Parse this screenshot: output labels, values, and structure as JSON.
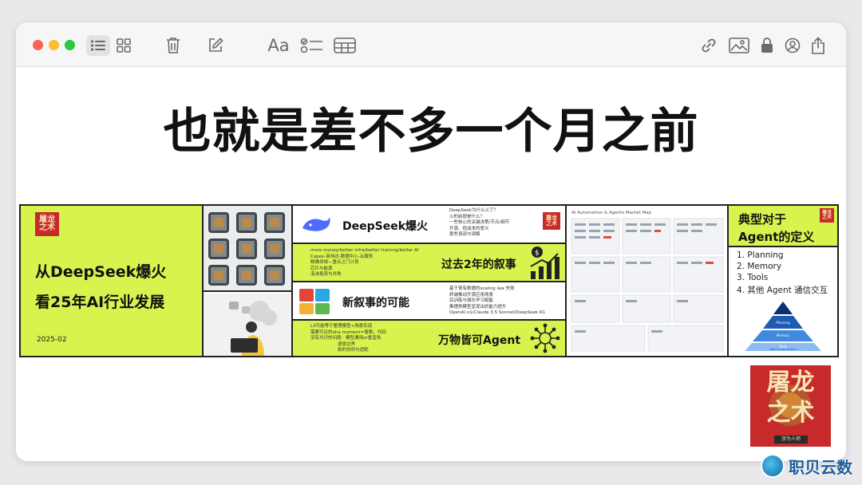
{
  "toolbar": {
    "buttons": [
      "list-view",
      "gallery-view",
      "delete",
      "compose",
      "format",
      "checklist",
      "table",
      "link",
      "media",
      "lock",
      "collaborate",
      "share"
    ],
    "format_label": "Aa"
  },
  "note": {
    "headline": "也就是差不多一个月之前"
  },
  "slides": {
    "cover": {
      "seal": "屠龙\n之术",
      "line1": "从DeepSeek爆火",
      "line2": "看25年AI行业发展",
      "date": "2025-02"
    },
    "deepseek": {
      "title": "DeepSeek爆火",
      "bullets": [
        "DeepSeek为什么火了？",
        "火的前提是什么？",
        "一些核心的关键决策/节点/细节",
        "开源、低成本的意义",
        "那些误读与误解"
      ]
    },
    "past": {
      "title": "过去2年的叙事",
      "bullets": [
        "more money/better infra/better training/better AI",
        "Capex-英伟达-数据中心-云服务",
        "精确领域—重点之门计划",
        "芯片与能源",
        "泡沫投资与并购"
      ]
    },
    "new": {
      "title": "新叙事的可能",
      "bullets": [
        "基于很有数据的scaling law 失败",
        "终端推动开源应用场景",
        "后训练与强化学习赋能",
        "推理类模型显现出的能力提升",
        "OpenAI o1/Claude 3.5 Sonnet/DeepSeek R1"
      ]
    },
    "agent": {
      "title": "万物皆可Agent",
      "bullets": [
        "L3可能等于整理模型+场景实现",
        "需要可见的aha moment=搜索，代码",
        "没有共识的问题：模型通用or垂直场",
        "语景边界",
        "新的协同与适配"
      ]
    },
    "market_map": {
      "title": "AI Automation & Agents Market Map"
    },
    "definition": {
      "seal": "屠龙\n之术",
      "title_line1": "典型对于",
      "title_line2": "Agent的定义",
      "items": [
        "1. Planning",
        "2. Memory",
        "3. Tools",
        "4. 其他 Agent 通信交互"
      ],
      "pyramid_levels": [
        "Planning",
        "Memory",
        "Tools",
        "Agent Communication"
      ]
    }
  },
  "corner_logo": {
    "text": "屠龙\n之术",
    "tagline": "涉为人师"
  },
  "watermark": {
    "text": "职贝云数"
  }
}
